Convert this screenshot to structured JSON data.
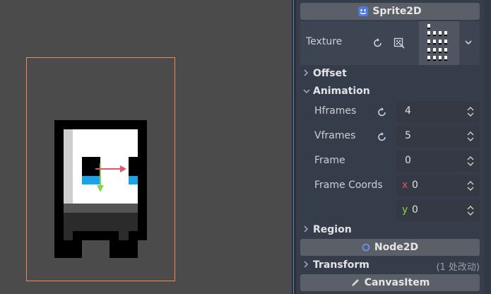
{
  "colors": {
    "viewport_bg": "#4b4b4b",
    "selection": "#e88b60",
    "gizmo_x": "#e0576a",
    "gizmo_y": "#8ed14f",
    "inspector_bg": "#363d4a",
    "header_bg": "#5b5f67",
    "sprite_icon": "#4c7ae0",
    "node2d_icon": "#6e8ff0"
  },
  "headers": {
    "sprite2d": "Sprite2D",
    "node2d": "Node2D",
    "canvasitem": "CanvasItem"
  },
  "texture": {
    "label": "Texture"
  },
  "sections": {
    "offset": "Offset",
    "animation": "Animation",
    "region": "Region",
    "transform": "Transform",
    "transform_note": "(1 处改动)"
  },
  "properties": {
    "hframes": {
      "label": "Hframes",
      "value": "4"
    },
    "vframes": {
      "label": "Vframes",
      "value": "5"
    },
    "frame": {
      "label": "Frame",
      "value": "0"
    },
    "frame_coords": {
      "label": "Frame Coords",
      "x_label": "x",
      "x_value": "0",
      "y_label": "y",
      "y_value": "0"
    }
  }
}
